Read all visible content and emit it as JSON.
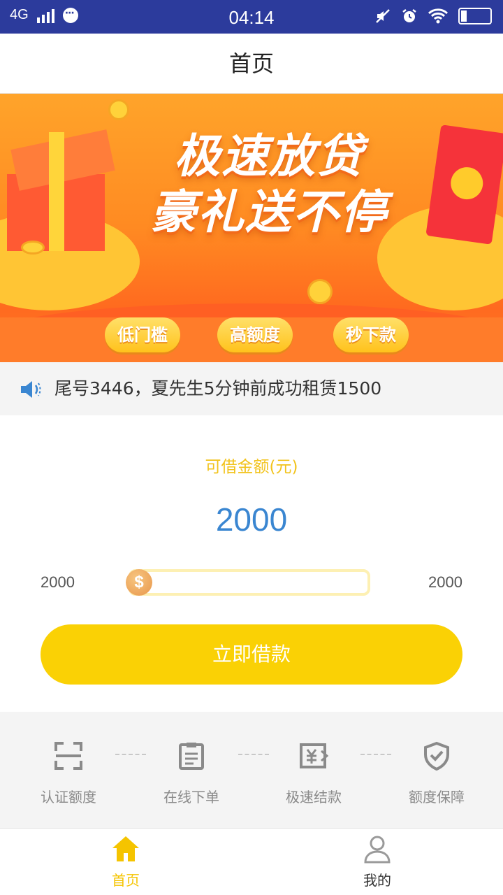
{
  "status_bar": {
    "network": "4G",
    "time": "04:14"
  },
  "header": {
    "title": "首页"
  },
  "banner": {
    "title_line1": "极速放贷",
    "title_line2": "豪礼送不停",
    "tags": [
      "低门槛",
      "高额度",
      "秒下款"
    ]
  },
  "notice": {
    "text": "尾号3446，夏先生5分钟前成功租赁1500"
  },
  "loan": {
    "label": "可借金额(元)",
    "amount": "2000",
    "min": "2000",
    "max": "2000",
    "slider_symbol": "$",
    "button_label": "立即借款"
  },
  "steps": [
    {
      "label": "认证额度",
      "icon": "scan-icon"
    },
    {
      "label": "在线下单",
      "icon": "clipboard-icon"
    },
    {
      "label": "极速结款",
      "icon": "yen-card-icon"
    },
    {
      "label": "额度保障",
      "icon": "shield-check-icon"
    }
  ],
  "tabs": [
    {
      "label": "首页",
      "icon": "home-icon",
      "active": true
    },
    {
      "label": "我的",
      "icon": "user-icon",
      "active": false
    }
  ],
  "colors": {
    "status_bar": "#2c3b9c",
    "accent_yellow": "#fad105",
    "amount_blue": "#3a86d1",
    "label_yellow": "#f2c31c",
    "tab_active": "#f5c400",
    "tab_inactive": "#9a9a9a"
  }
}
